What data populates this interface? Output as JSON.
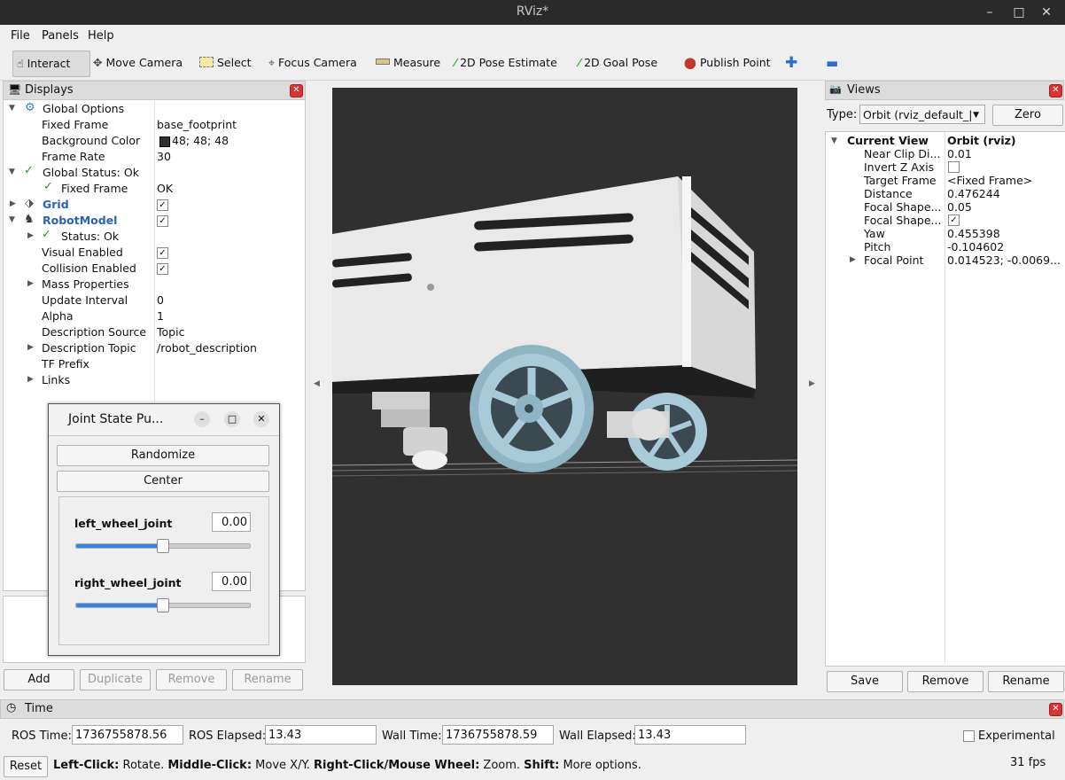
{
  "window": {
    "title": "RViz*"
  },
  "menu": [
    "File",
    "Panels",
    "Help"
  ],
  "toolbar": {
    "interact": "Interact",
    "move_camera": "Move Camera",
    "select": "Select",
    "focus_camera": "Focus Camera",
    "measure": "Measure",
    "pose_estimate": "2D Pose Estimate",
    "goal_pose": "2D Goal Pose",
    "publish_point": "Publish Point"
  },
  "displays": {
    "title": "Displays",
    "rows": {
      "global_options": "Global Options",
      "fixed_frame": "Fixed Frame",
      "fixed_frame_val": "base_footprint",
      "bg_color": "Background Color",
      "bg_color_val": "48; 48; 48",
      "frame_rate": "Frame Rate",
      "frame_rate_val": "30",
      "global_status": "Global Status: Ok",
      "gs_fixed_frame": "Fixed Frame",
      "gs_fixed_frame_val": "OK",
      "grid": "Grid",
      "robot_model": "RobotModel",
      "status": "Status: Ok",
      "visual_enabled": "Visual Enabled",
      "collision_enabled": "Collision Enabled",
      "mass_properties": "Mass Properties",
      "update_interval": "Update Interval",
      "update_interval_val": "0",
      "alpha": "Alpha",
      "alpha_val": "1",
      "desc_source": "Description Source",
      "desc_source_val": "Topic",
      "desc_topic": "Description Topic",
      "desc_topic_val": "/robot_description",
      "tf_prefix": "TF Prefix",
      "links": "Links"
    },
    "buttons": {
      "add": "Add",
      "duplicate": "Duplicate",
      "remove": "Remove",
      "rename": "Rename"
    }
  },
  "joint_state": {
    "title": "Joint State Pu...",
    "randomize": "Randomize",
    "center": "Center",
    "left_label": "left_wheel_joint",
    "left_value": "0.00",
    "left_level": 0.5,
    "right_label": "right_wheel_joint",
    "right_value": "0.00",
    "right_level": 0.5
  },
  "views": {
    "title": "Views",
    "type_label": "Type:",
    "type_value": "Orbit (rviz_default_|",
    "zero": "Zero",
    "current_view": "Current View",
    "current_view_val": "Orbit (rviz)",
    "props": [
      {
        "k": "Near Clip Di...",
        "v": "0.01"
      },
      {
        "k": "Invert Z Axis",
        "v": ""
      },
      {
        "k": "Target Frame",
        "v": "<Fixed Frame>"
      },
      {
        "k": "Distance",
        "v": "0.476244"
      },
      {
        "k": "Focal Shape...",
        "v": "0.05"
      },
      {
        "k": "Focal Shape...",
        "v": ""
      },
      {
        "k": "Yaw",
        "v": "0.455398"
      },
      {
        "k": "Pitch",
        "v": "-0.104602"
      },
      {
        "k": "Focal Point",
        "v": "0.014523; -0.0069..."
      }
    ],
    "save": "Save",
    "remove": "Remove",
    "rename": "Rename"
  },
  "time": {
    "title": "Time",
    "ros_time_label": "ROS Time:",
    "ros_time": "1736755878.56",
    "ros_elapsed_label": "ROS Elapsed:",
    "ros_elapsed": "13.43",
    "wall_time_label": "Wall Time:",
    "wall_time": "1736755878.59",
    "wall_elapsed_label": "Wall Elapsed:",
    "wall_elapsed": "13.43",
    "experimental": "Experimental"
  },
  "status": {
    "reset": "Reset",
    "left_click": "Left-Click:",
    "rotate": " Rotate. ",
    "middle_click": "Middle-Click:",
    "move": " Move X/Y. ",
    "right_click": "Right-Click/Mouse Wheel:",
    "zoom": " Zoom. ",
    "shift": "Shift:",
    "more": " More options.",
    "fps": "31 fps"
  },
  "colors": {
    "viewport_bg": "#303030",
    "accent": "#3584e4"
  }
}
